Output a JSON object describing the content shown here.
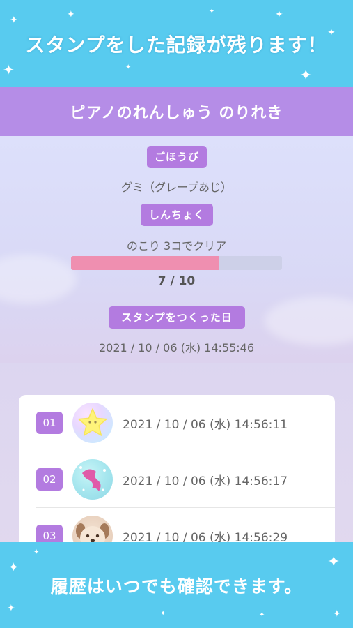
{
  "top_banner": {
    "text": "スタンプをした記録が残ります！"
  },
  "header": {
    "title": "ピアノのれんしゅう のりれき"
  },
  "info": {
    "reward_label": "ごほうび",
    "reward_value": "グミ（グレープあじ）",
    "progress_label": "しんちょく",
    "progress_remaining": "のこり 3コでクリア",
    "progress_text": "7 / 10",
    "progress_fraction": 0.7,
    "created_label": "スタンプをつくった日",
    "created_value": "2021 / 10 / 06 (水) 14:55:46"
  },
  "history": {
    "items": [
      {
        "number": "01",
        "stamp_icon": "star-stamp-icon",
        "time": "2021 / 10 / 06 (水) 14:56:11"
      },
      {
        "number": "02",
        "stamp_icon": "mermaid-stamp-icon",
        "time": "2021 / 10 / 06 (水) 14:56:17"
      },
      {
        "number": "03",
        "stamp_icon": "dog-stamp-icon",
        "time": "2021 / 10 / 06 (水) 14:56:29"
      }
    ]
  },
  "bottom_banner": {
    "text": "履歴はいつでも確認できます。"
  },
  "colors": {
    "banner": "#58cbef",
    "header": "#b58de7",
    "badge": "#b37be0",
    "progress_fill": "#ef8fb0",
    "progress_track": "#cdd0e8"
  }
}
